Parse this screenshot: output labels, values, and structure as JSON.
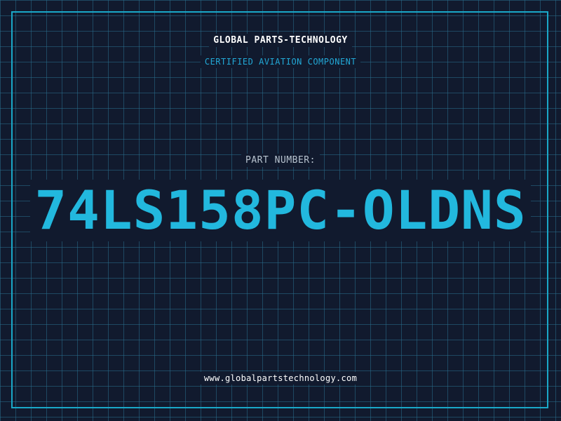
{
  "header": {
    "company": "GLOBAL PARTS-TECHNOLOGY",
    "subtitle": "CERTIFIED AVIATION COMPONENT"
  },
  "main": {
    "part_label": "PART NUMBER:",
    "part_number": "74LS158PC-OLDNS"
  },
  "footer": {
    "website": "www.globalpartstechnology.com"
  },
  "colors": {
    "background": "#111a2e",
    "grid": "#286e8c",
    "frame": "#1aa8c8",
    "accent": "#22b8de",
    "text": "#ffffff"
  }
}
